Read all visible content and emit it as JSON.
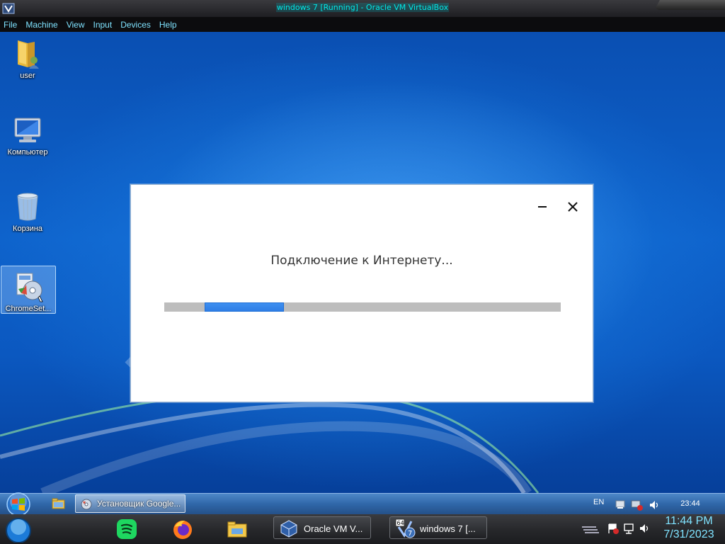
{
  "vbox": {
    "title": "windows 7 [Running] - Oracle VM VirtualBox",
    "menu": [
      "File",
      "Machine",
      "View",
      "Input",
      "Devices",
      "Help"
    ]
  },
  "desktop": {
    "icons": [
      {
        "label": "user",
        "icon": "user-folder-icon"
      },
      {
        "label": "Компьютер",
        "icon": "computer-icon"
      },
      {
        "label": "Корзина",
        "icon": "recycle-bin-icon"
      },
      {
        "label": "ChromeSet...",
        "icon": "installer-icon",
        "selected": true
      }
    ]
  },
  "installer_dialog": {
    "message": "Подключение к Интернету...",
    "progress": {
      "state": "indeterminate",
      "color": "#2f7ee6"
    }
  },
  "guest_taskbar": {
    "active_task_label": "Установщик Google...",
    "language": "EN",
    "clock": "23:44"
  },
  "host_taskbar": {
    "pinned": [
      "spotify-icon",
      "firefox-icon",
      "file-explorer-icon"
    ],
    "tasks": [
      {
        "label": "Oracle VM V...",
        "icon": "virtualbox-icon"
      },
      {
        "label": "windows 7 [...",
        "icon": "vm-windows7-icon"
      }
    ],
    "clock_time": "11:44 PM",
    "clock_date": "7/31/2023"
  },
  "colors": {
    "accent_cyan": "#7fe3ff",
    "desktop_blue": "#0e63cc",
    "progress_blue": "#2f7ee6"
  }
}
